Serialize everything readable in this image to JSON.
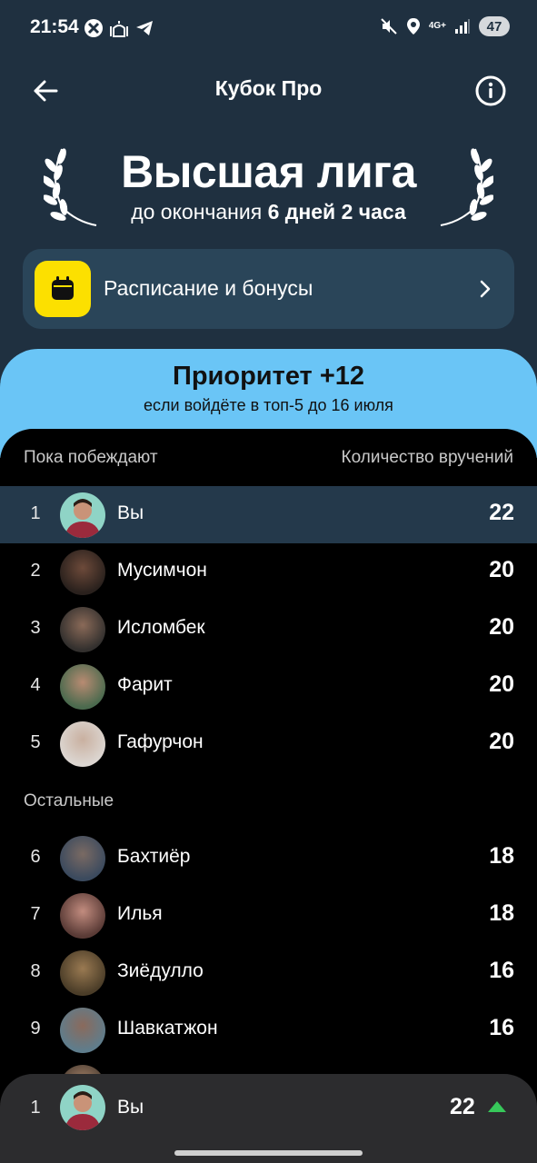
{
  "status_bar": {
    "time": "21:54",
    "network": "4G+",
    "battery": "47"
  },
  "header": {
    "title": "Кубок Про"
  },
  "league": {
    "title": "Высшая лига",
    "deadline_prefix": "до окончания ",
    "deadline_value": "6 дней 2 часа"
  },
  "schedule": {
    "label": "Расписание и бонусы"
  },
  "priority": {
    "title": "Приоритет +12",
    "subtitle": "если войдёте в топ-5 до 16 июля"
  },
  "leaderboard": {
    "col_left": "Пока побеждают",
    "col_right": "Количество вручений",
    "others_label": "Остальные",
    "top": [
      {
        "rank": "1",
        "name": "Вы",
        "count": "22"
      },
      {
        "rank": "2",
        "name": "Мусимчон",
        "count": "20"
      },
      {
        "rank": "3",
        "name": "Исломбек",
        "count": "20"
      },
      {
        "rank": "4",
        "name": "Фарит",
        "count": "20"
      },
      {
        "rank": "5",
        "name": "Гафурчон",
        "count": "20"
      }
    ],
    "others": [
      {
        "rank": "6",
        "name": "Бахтиёр",
        "count": "18"
      },
      {
        "rank": "7",
        "name": "Илья",
        "count": "18"
      },
      {
        "rank": "8",
        "name": "Зиёдулло",
        "count": "16"
      },
      {
        "rank": "9",
        "name": "Шавкатжон",
        "count": "16"
      }
    ]
  },
  "me_sticky": {
    "rank": "1",
    "name": "Вы",
    "count": "22"
  },
  "colors": {
    "header_bg": "#1f3040",
    "accent_yellow": "#fce000",
    "banner_blue": "#6ac5f6",
    "highlight_row": "#24394b",
    "trend_up": "#37c85a"
  }
}
